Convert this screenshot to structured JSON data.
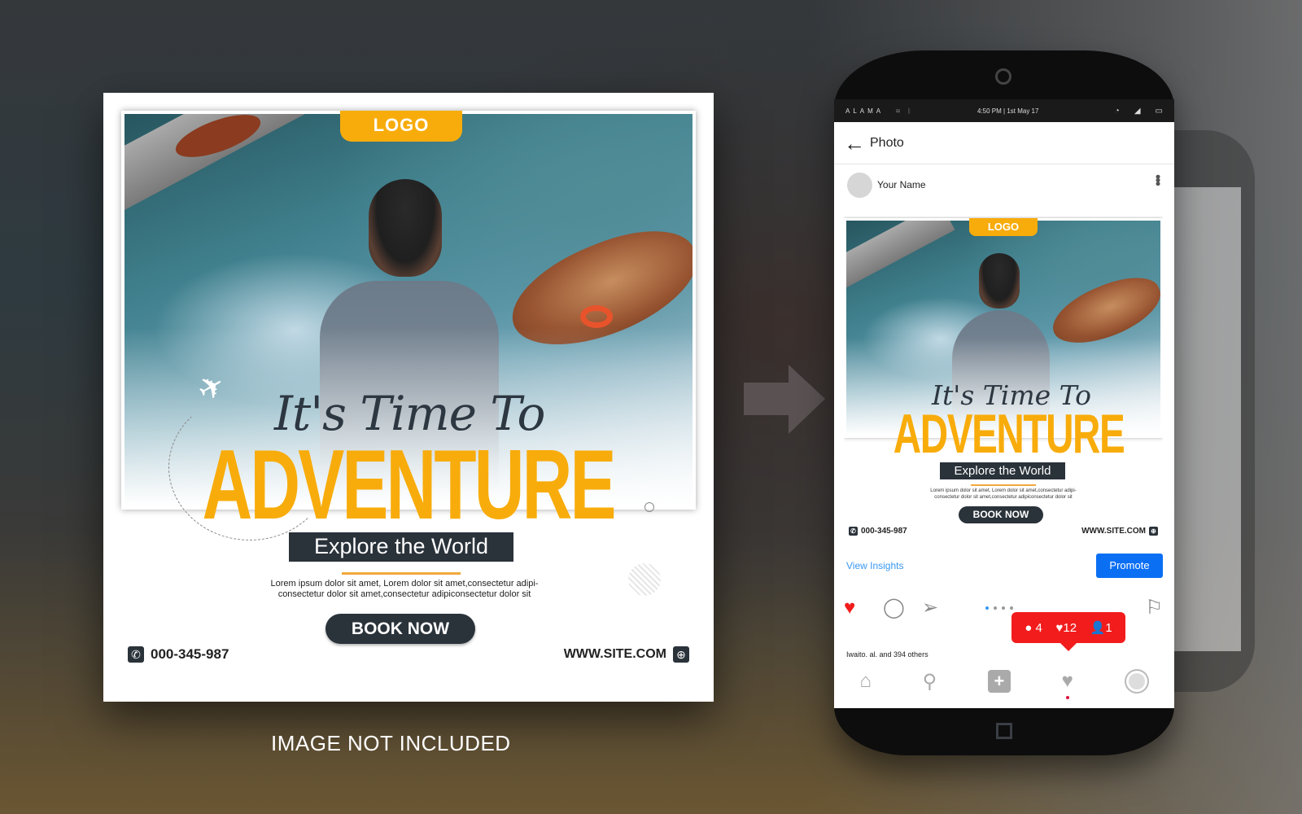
{
  "flyer": {
    "logo": "LOGO",
    "script_title": "It's Time To",
    "headline": "ADVENTURE",
    "subtitle": "Explore the World",
    "body_text": "Lorem ipsum dolor sit amet, Lorem dolor sit amet,consectetur  adipi- consectetur dolor sit amet,consectetur  adipiconsectetur dolor sit",
    "cta": "BOOK NOW",
    "phone": "000-345-987",
    "website": "WWW.SITE.COM",
    "icons": {
      "plane": "plane-icon",
      "phone": "phone-icon",
      "globe": "globe-icon"
    }
  },
  "caption": "IMAGE NOT INCLUDED",
  "phone": {
    "status_bar": {
      "carrier": "ALAMA",
      "time": "4:50 PM | 1st May 17",
      "icons": [
        "wifi-icon",
        "bluetooth-icon",
        "alarm-icon",
        "signal-icon",
        "battery-icon"
      ]
    },
    "header": {
      "back_glyph": "←",
      "title": "Photo"
    },
    "post": {
      "user_name": "Your Name",
      "more_glyph": "•••",
      "view_insights": "View Insights",
      "promote": "Promote",
      "likes_text": "Iwaito. al. and 394 others"
    },
    "notification": {
      "comments": "4",
      "likes": "12",
      "followers": "1",
      "color": "#f21c1c"
    },
    "carousel": {
      "total": 4,
      "active": 1
    },
    "bottom_nav": [
      "home-icon",
      "search-icon",
      "add-icon",
      "heart-icon",
      "profile-icon"
    ],
    "accent": "#0b6ff4",
    "brand_orange": "#f8ac0b"
  }
}
